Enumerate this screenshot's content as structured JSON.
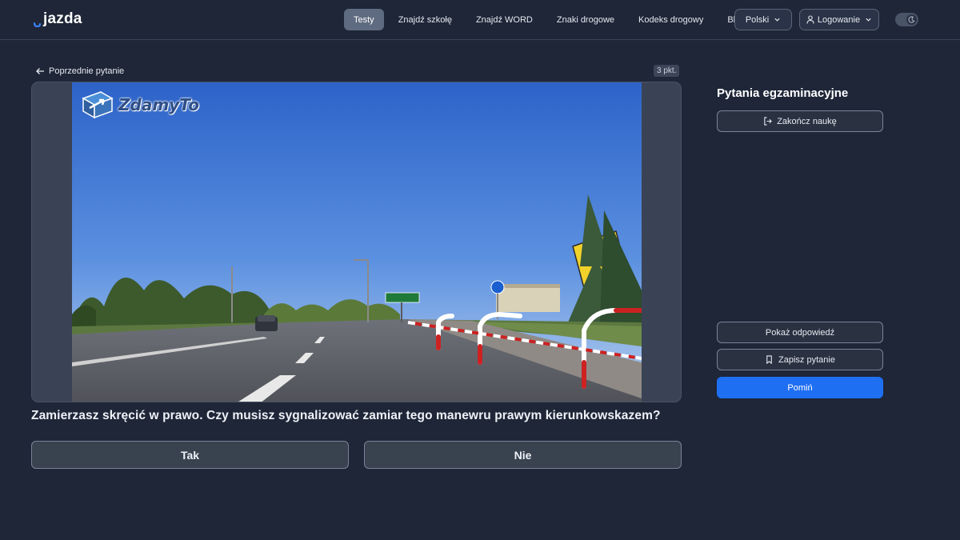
{
  "header": {
    "logo_text": "jazda",
    "nav": [
      {
        "label": "Testy",
        "active": true
      },
      {
        "label": "Znajdź szkołę",
        "active": false
      },
      {
        "label": "Znajdź WORD",
        "active": false
      },
      {
        "label": "Znaki drogowe",
        "active": false
      },
      {
        "label": "Kodeks drogowy",
        "active": false
      },
      {
        "label": "Blog",
        "active": false
      }
    ],
    "language": "Polski",
    "login": "Logowanie",
    "theme_icon": "moon-icon"
  },
  "main": {
    "prev_label": "Poprzednie pytanie",
    "points": "3 pkt.",
    "watermark": "ZdamyTo",
    "question": "Zamierzasz skręcić w prawo. Czy musisz sygnalizować zamiar tego manewru prawym kierunkowskazem?",
    "answers": [
      "Tak",
      "Nie"
    ]
  },
  "sidebar": {
    "title": "Pytania egzaminacyjne",
    "finish_label": "Zakończ naukę",
    "show_answer_label": "Pokaż odpowiedź",
    "save_label": "Zapisz pytanie",
    "skip_label": "Pomiń"
  },
  "colors": {
    "background": "#1e2638",
    "accent": "#1f6ff2",
    "active_nav": "#5f6b80"
  }
}
